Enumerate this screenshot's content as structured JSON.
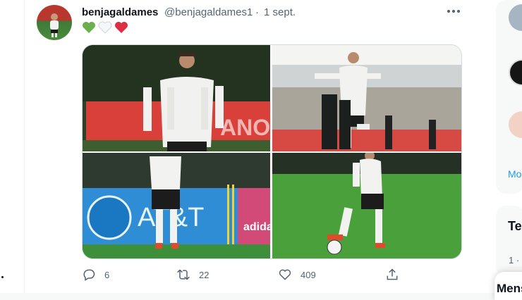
{
  "tweet": {
    "display_name": "benjagaldames",
    "handle": "@benjagaldames1",
    "separator": "·",
    "date": "1 sept.",
    "emoji": [
      "green-heart",
      "white-heart",
      "red-heart"
    ],
    "photos": [
      {
        "id": "photo-1",
        "banner_text": "ANO"
      },
      {
        "id": "photo-2"
      },
      {
        "id": "photo-3",
        "sponsor_text": "AT&T",
        "brand_text": "adida"
      },
      {
        "id": "photo-4"
      }
    ],
    "actions": {
      "replies": "6",
      "retweets": "22",
      "likes": "409"
    }
  },
  "sidebar": {
    "more_link": "Mo",
    "trends_title": "Te",
    "trend_rank": "1 ·"
  },
  "messages_drawer": {
    "label": "Mens"
  },
  "colors": {
    "text": "#0f1419",
    "secondary": "#536471",
    "link": "#1d9bf0",
    "heart_green": "#6ab04c",
    "heart_red": "#dd2e44"
  }
}
